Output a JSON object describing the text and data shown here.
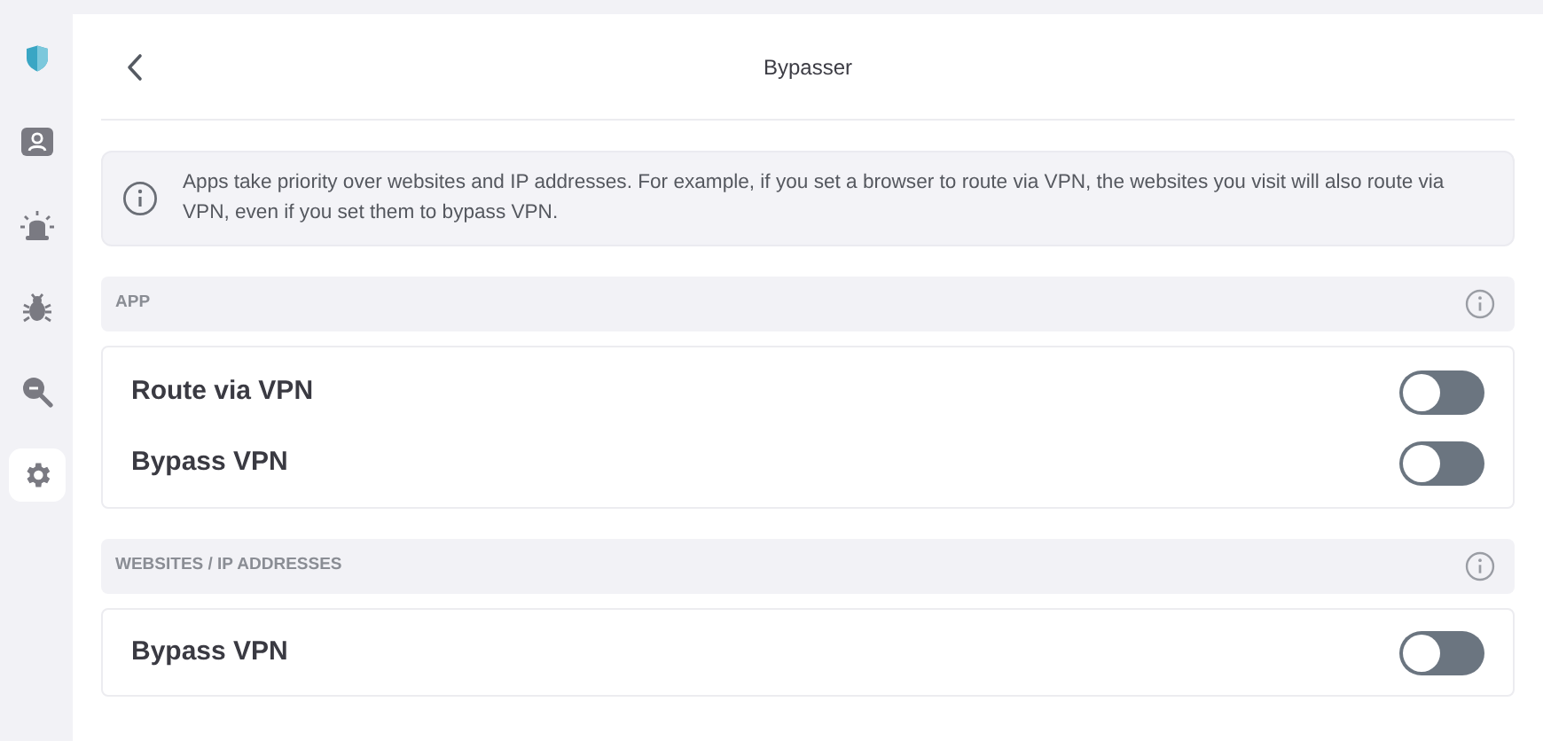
{
  "sidebar": {
    "items": [
      {
        "kind": "shield",
        "selected": false
      },
      {
        "kind": "profile",
        "selected": false
      },
      {
        "kind": "alarm",
        "selected": false
      },
      {
        "kind": "bug",
        "selected": false
      },
      {
        "kind": "search",
        "selected": false
      },
      {
        "kind": "settings",
        "selected": true
      }
    ]
  },
  "header": {
    "title": "Bypasser"
  },
  "info": {
    "text": "Apps take priority over websites and IP addresses. For example, if you set a browser to route via VPN, the websites you visit will also route via VPN, even if you set them to bypass VPN."
  },
  "sections": [
    {
      "title": "APP",
      "rows": [
        {
          "label": "Route via VPN",
          "on": false
        },
        {
          "label": "Bypass VPN",
          "on": false
        }
      ]
    },
    {
      "title": "WEBSITES / IP ADDRESSES",
      "rows": [
        {
          "label": "Bypass VPN",
          "on": false
        }
      ]
    }
  ]
}
